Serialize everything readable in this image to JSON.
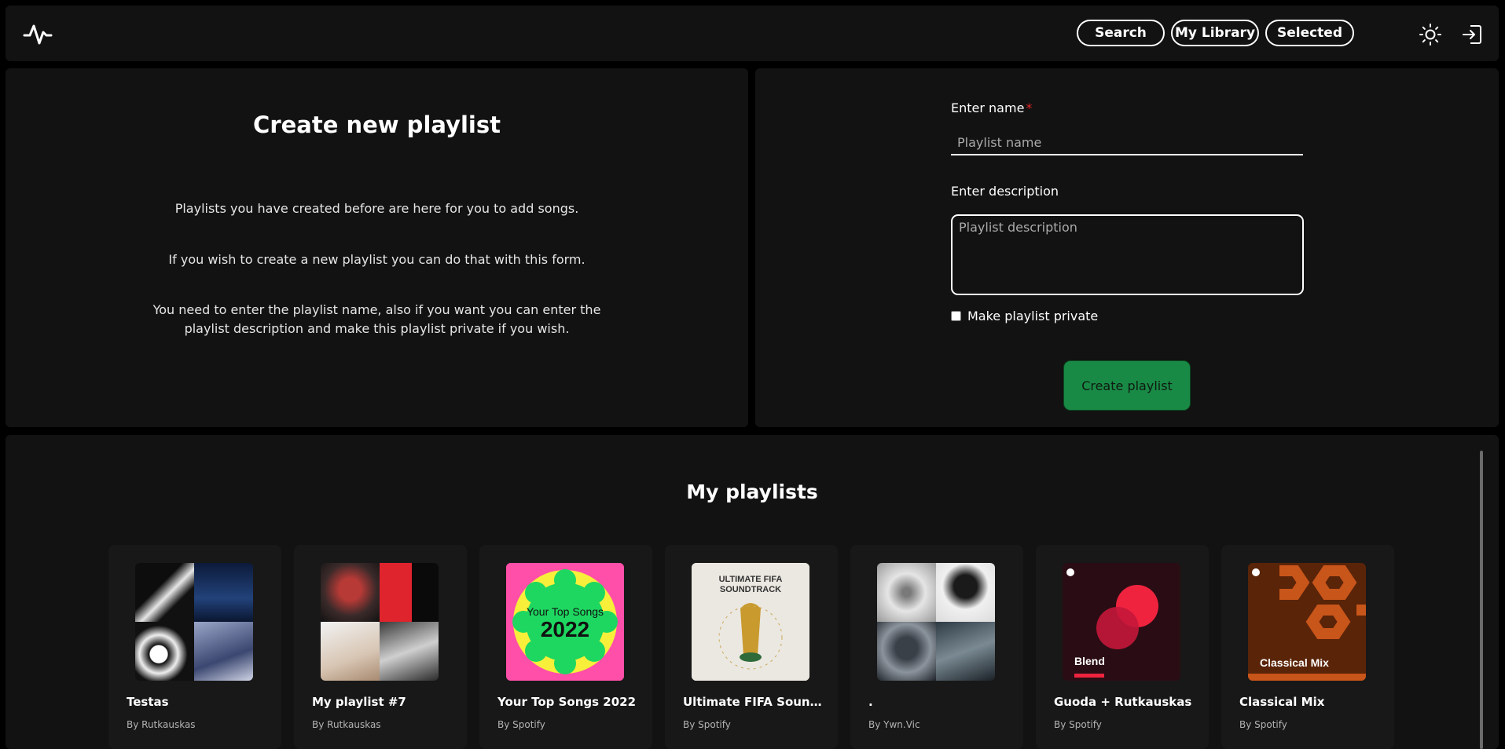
{
  "nav": {
    "search": "Search",
    "library": "My Library",
    "selected": "Selected",
    "logo_icon": "pulse-icon",
    "theme_icon": "sun-icon",
    "logout_icon": "logout-icon"
  },
  "create": {
    "title": "Create new playlist",
    "info1": "Playlists you have created before are here for you to add songs.",
    "info2": "If you wish to create a new playlist you can do that with this form.",
    "info3": "You need to enter the playlist name, also if you want you can enter the playlist description and make this playlist private if you wish."
  },
  "form": {
    "name_label": "Enter name",
    "required_mark": "*",
    "name_placeholder": "Playlist name",
    "name_value": "",
    "desc_label": "Enter description",
    "desc_placeholder": "Playlist description",
    "desc_value": "",
    "private_label": "Make playlist private",
    "private_checked": false,
    "submit_label": "Create playlist"
  },
  "my_playlists": {
    "title": "My playlists",
    "items": [
      {
        "title": "Testas",
        "owner": "By Rutkauskas"
      },
      {
        "title": "My playlist #7",
        "owner": "By Rutkauskas"
      },
      {
        "title": "Your Top Songs 2022",
        "owner": "By Spotify",
        "cover_text": "Your Top Songs 2022"
      },
      {
        "title": "Ultimate FIFA Soundtrack",
        "owner": "By Spotify",
        "cover_text": "ULTIMATE FIFA SOUNDTRACK"
      },
      {
        "title": ".",
        "owner": "By Ywn.Vic"
      },
      {
        "title": "Guoda + Rutkauskas",
        "owner": "By Spotify",
        "cover_text": "Blend"
      },
      {
        "title": "Classical Mix",
        "owner": "By Spotify",
        "cover_text": "Classical Mix"
      }
    ]
  },
  "colors": {
    "background": "#000000",
    "panel": "#121212",
    "card": "#181818",
    "accent_green": "#198a45",
    "required_red": "#e02424"
  }
}
